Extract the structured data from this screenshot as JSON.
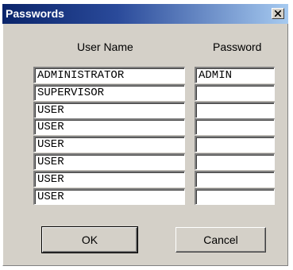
{
  "window": {
    "title": "Passwords",
    "close_icon": "close-icon"
  },
  "columns": {
    "user_name": "User Name",
    "password": "Password"
  },
  "rows": [
    {
      "user": "ADMINISTRATOR",
      "password": "ADMIN"
    },
    {
      "user": "SUPERVISOR",
      "password": ""
    },
    {
      "user": "USER",
      "password": ""
    },
    {
      "user": "USER",
      "password": ""
    },
    {
      "user": "USER",
      "password": ""
    },
    {
      "user": "USER",
      "password": ""
    },
    {
      "user": "USER",
      "password": ""
    },
    {
      "user": "USER",
      "password": ""
    }
  ],
  "buttons": {
    "ok": "OK",
    "cancel": "Cancel"
  }
}
